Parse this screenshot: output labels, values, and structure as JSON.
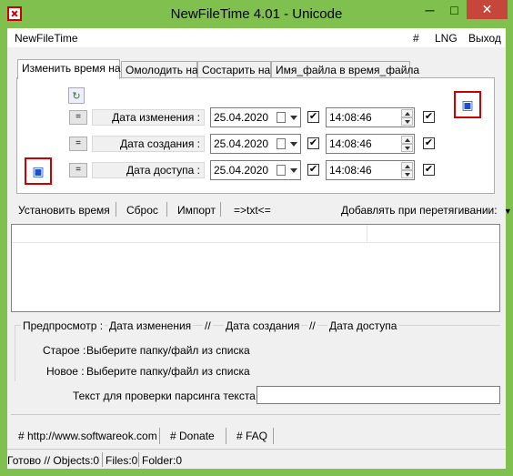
{
  "window": {
    "title": "NewFileTime 4.01 - Unicode",
    "minimize": "─",
    "maximize": "□",
    "close": "✕",
    "frame_color": "#80c04e"
  },
  "menu": {
    "app": "NewFileTime",
    "hash": "#",
    "lng": "LNG",
    "exit": "Выход"
  },
  "tabs": [
    {
      "label": "Изменить время на",
      "active": true
    },
    {
      "label": "Омолодить на",
      "active": false
    },
    {
      "label": "Состарить на",
      "active": false
    },
    {
      "label": "Имя_файла в время_файла",
      "active": false
    }
  ],
  "rows": [
    {
      "eq": "=",
      "label": "Дата изменения :",
      "date": "25.04.2020",
      "date_checked": "✔",
      "time": "14:08:46",
      "time_checked": "✔"
    },
    {
      "eq": "=",
      "label": "Дата создания :",
      "date": "25.04.2020",
      "date_checked": "✔",
      "time": "14:08:46",
      "time_checked": "✔"
    },
    {
      "eq": "=",
      "label": "Дата доступа :",
      "date": "25.04.2020",
      "date_checked": "✔",
      "time": "14:08:46",
      "time_checked": "✔"
    }
  ],
  "toolbar": {
    "set_time": "Установить время",
    "reset": "Сброс",
    "import": "Импорт",
    "txt": "=>txt<=",
    "add_on_drag": "Добавлять при перетягивании:",
    "dropdown_arrow": "▼"
  },
  "preview": {
    "title": "Предпросмотр  :",
    "col1": "Дата изменения",
    "sep1": "//",
    "col2": "Дата создания",
    "sep2": "//",
    "col3": "Дата доступа",
    "old_label": "Старое :",
    "old_value": "Выберите папку/файл из списка",
    "new_label": "Новое :",
    "new_value": "Выберите папку/файл из списка"
  },
  "parse": {
    "label": "Текст для проверки парсинга текста во время",
    "value": ""
  },
  "links": {
    "website": "# http://www.softwareok.com",
    "donate": "# Donate",
    "faq": "# FAQ"
  },
  "status": {
    "ready": "Готово // Objects:0",
    "files": "Files:0",
    "folder": "Folder:0"
  },
  "icons": {
    "app": "app-icon",
    "refresh": "↻",
    "drag_top": "▣",
    "drag_left": "▣"
  }
}
